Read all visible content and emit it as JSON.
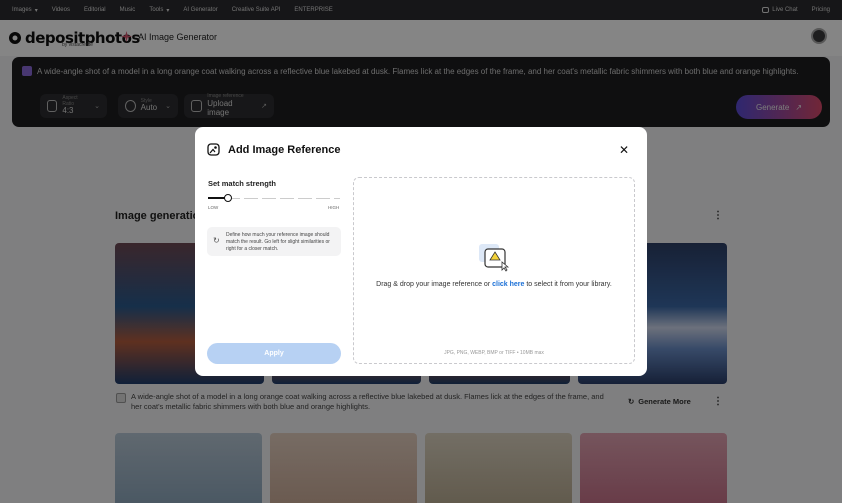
{
  "topnav": {
    "items": [
      {
        "label": "Images",
        "dropdown": true
      },
      {
        "label": "Videos",
        "dropdown": false
      },
      {
        "label": "Editorial",
        "dropdown": false
      },
      {
        "label": "Music",
        "dropdown": false
      },
      {
        "label": "Tools",
        "dropdown": true
      },
      {
        "label": "AI Generator",
        "dropdown": false
      },
      {
        "label": "Creative Suite API",
        "dropdown": false
      },
      {
        "label": "ENTERPRISE",
        "dropdown": false
      }
    ],
    "live_chat": "Live Chat",
    "pricing": "Pricing"
  },
  "header": {
    "logo": "depositphotos",
    "logo_sub": "by vistacreate",
    "page_title": "AI Image Generator"
  },
  "prompt": {
    "text": "A wide-angle shot of a model in a long orange coat walking across a reflective blue lakebed at dusk. Flames lick at the edges of the frame, and her coat's metallic fabric shimmers with both blue and orange highlights.",
    "options": [
      {
        "label": "Aspect Ratio",
        "value": "4:3",
        "icon": "aspect-ratio-icon"
      },
      {
        "label": "Style",
        "value": "Auto",
        "icon": "style-icon"
      },
      {
        "label": "Image reference",
        "value": "Upload image",
        "icon": "image-reference-icon"
      }
    ],
    "generate_label": "Generate"
  },
  "results": {
    "title": "Image generation",
    "caption": "A wide-angle shot of a model in a long orange coat walking across a reflective blue lakebed at dusk. Flames lick at the edges of the frame, and her coat's metallic fabric shimmers with both blue and orange highlights.",
    "generate_more": "Generate More"
  },
  "modal": {
    "title": "Add Image Reference",
    "match_label": "Set match strength",
    "low": "LOW",
    "high": "HIGH",
    "match_strength": 0.15,
    "info": "Define how much your reference image should match the result. Go left for slight similarities or right for a closer match.",
    "apply": "Apply",
    "drop_text_before": "Drag & drop your image reference or ",
    "drop_link": "click here",
    "drop_text_after": " to select it from your library.",
    "formats": "JPG, PNG, WEBP, BMP or TIFF • 10MB max"
  },
  "colors": {
    "accent": "#1a6fd6",
    "generate_gradient_start": "#5a4bd6",
    "generate_gradient_end": "#d94a6a",
    "apply_disabled": "#b7d1f3"
  }
}
